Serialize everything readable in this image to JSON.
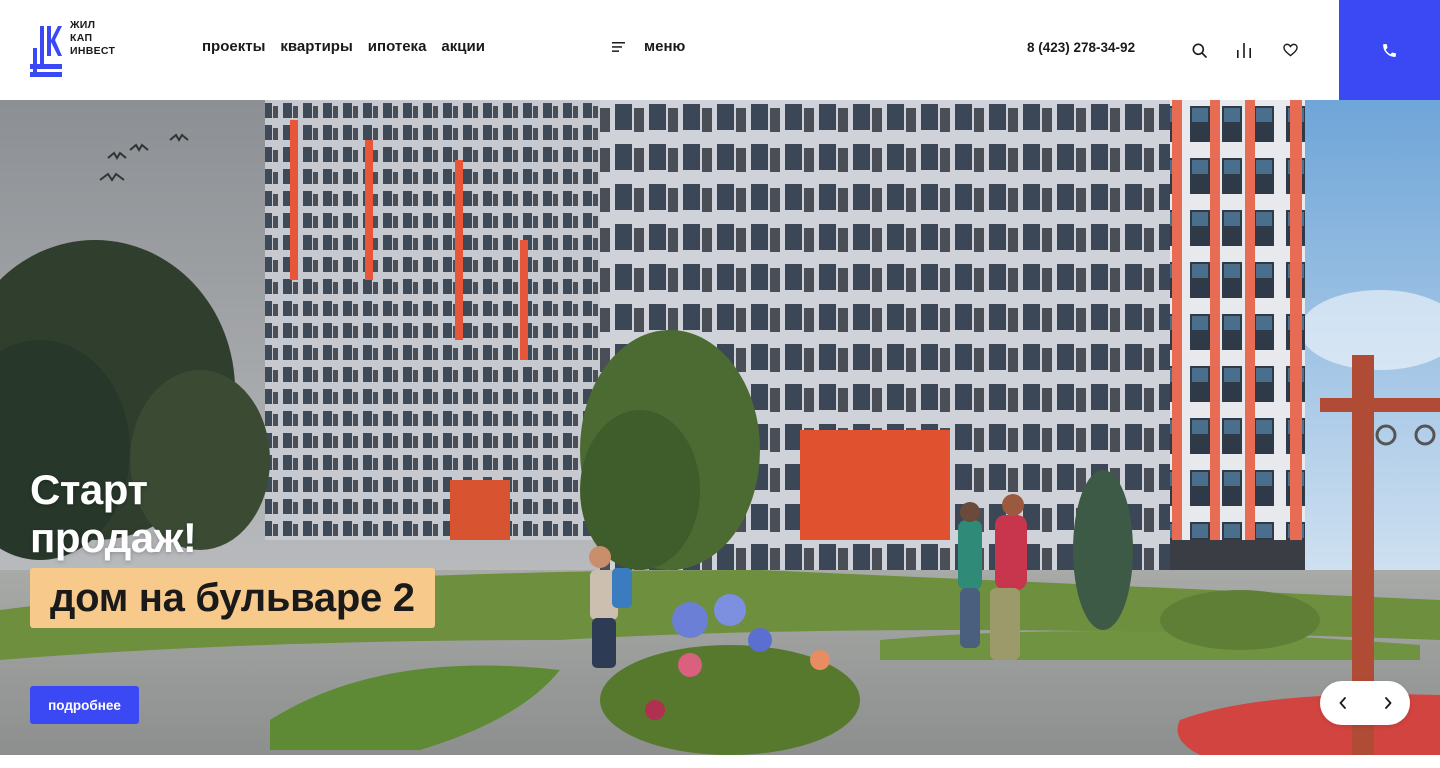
{
  "logo": {
    "lines": [
      "ЖИЛ",
      "КАП",
      "ИНВЕСТ"
    ]
  },
  "nav": [
    {
      "label": "проекты"
    },
    {
      "label": "квартиры"
    },
    {
      "label": "ипотека"
    },
    {
      "label": "акции"
    }
  ],
  "menu": {
    "label": "меню"
  },
  "contact": {
    "phone": "8 (423) 278-34-92"
  },
  "icons": {
    "search": "search-icon",
    "compare": "compare-bars-icon",
    "favorites": "heart-icon",
    "call": "phone-icon",
    "prev": "chevron-left-icon",
    "next": "chevron-right-icon"
  },
  "hero": {
    "title_line1": "Старт",
    "title_line2": "продаж!",
    "badge": "дом на бульваре 2",
    "button": "подробнее"
  },
  "colors": {
    "accent": "#3b49f5",
    "badge": "#f7c98a",
    "facade_orange": "#e8563a"
  }
}
